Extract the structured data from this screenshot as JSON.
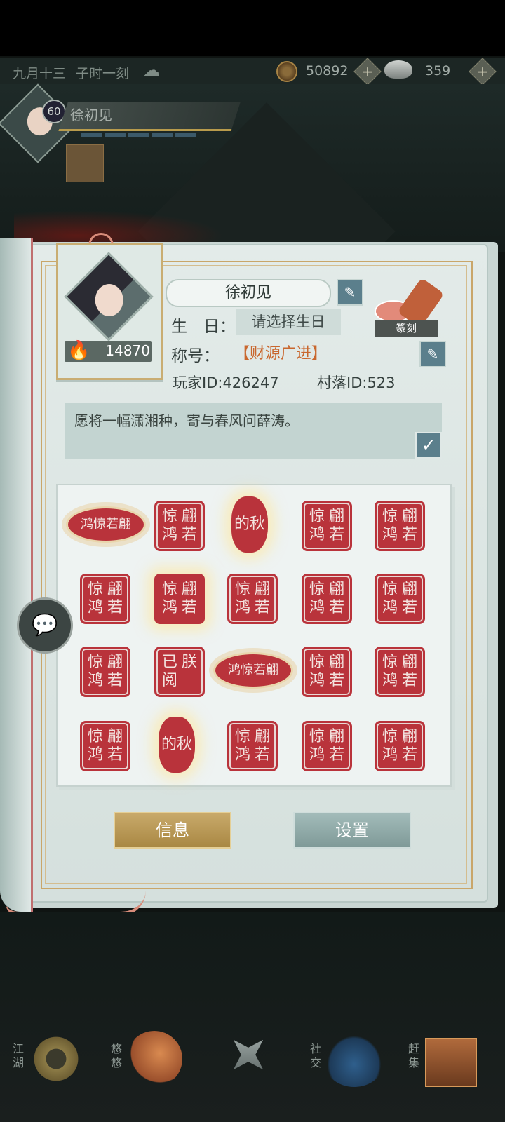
{
  "status_bar": {},
  "top_bar": {
    "date": "九月十三",
    "time": "子时一刻",
    "weather_icon": "cloud-icon",
    "copper_coins": "50892",
    "silver": "359"
  },
  "hud": {
    "level": "60",
    "player_name": "徐初见"
  },
  "profile": {
    "name": "徐初见",
    "birthday_label": "生　日：",
    "birthday_value": "请选择生日",
    "title_label": "称号：",
    "title_value": "【财源广进】",
    "player_id": "玩家ID:426247",
    "village_id": "村落ID:523",
    "score": "14870",
    "seal_carving_label": "篆刻",
    "signature": "愿将一幅潇湘种，寄与春风问薛涛。",
    "edit_icon": "pencil-icon",
    "confirm_icon": "check-icon"
  },
  "seals": [
    {
      "style": "oval",
      "text": "鸿惊若翩"
    },
    {
      "style": "square",
      "chars": [
        "惊",
        "翩",
        "鸿",
        "若"
      ]
    },
    {
      "style": "round",
      "text": "的秋"
    },
    {
      "style": "square",
      "chars": [
        "惊",
        "翩",
        "鸿",
        "若"
      ]
    },
    {
      "style": "square",
      "chars": [
        "惊",
        "翩",
        "鸿",
        "若"
      ]
    },
    {
      "style": "square",
      "chars": [
        "惊",
        "翩",
        "鸿",
        "若"
      ]
    },
    {
      "style": "square-glow",
      "chars": [
        "惊",
        "翩",
        "鸿",
        "若"
      ]
    },
    {
      "style": "square",
      "chars": [
        "惊",
        "翩",
        "鸿",
        "若"
      ]
    },
    {
      "style": "square",
      "chars": [
        "惊",
        "翩",
        "鸿",
        "若"
      ]
    },
    {
      "style": "square",
      "chars": [
        "惊",
        "翩",
        "鸿",
        "若"
      ]
    },
    {
      "style": "square",
      "chars": [
        "惊",
        "翩",
        "鸿",
        "若"
      ]
    },
    {
      "style": "square",
      "chars": [
        "已",
        "朕",
        "阅",
        ""
      ]
    },
    {
      "style": "oval",
      "text": "鸿惊若翩"
    },
    {
      "style": "square",
      "chars": [
        "惊",
        "翩",
        "鸿",
        "若"
      ]
    },
    {
      "style": "square",
      "chars": [
        "惊",
        "翩",
        "鸿",
        "若"
      ]
    },
    {
      "style": "square",
      "chars": [
        "惊",
        "翩",
        "鸿",
        "若"
      ]
    },
    {
      "style": "round",
      "text": "的秋"
    },
    {
      "style": "square",
      "chars": [
        "惊",
        "翩",
        "鸿",
        "若"
      ]
    },
    {
      "style": "square",
      "chars": [
        "惊",
        "翩",
        "鸿",
        "若"
      ]
    },
    {
      "style": "square",
      "chars": [
        "惊",
        "翩",
        "鸿",
        "若"
      ]
    }
  ],
  "buttons": {
    "info": "信息",
    "settings": "设置",
    "chat_icon": "chat-bubble-icon"
  },
  "bottom_nav": [
    {
      "label": "江湖",
      "icon": "jianghu-icon"
    },
    {
      "label": "悠悠",
      "icon": "crane-icon"
    },
    {
      "label": "",
      "icon": "compass-star-icon"
    },
    {
      "label": "社交",
      "icon": "wave-icon"
    },
    {
      "label": "赶集",
      "icon": "basket-icon"
    }
  ]
}
